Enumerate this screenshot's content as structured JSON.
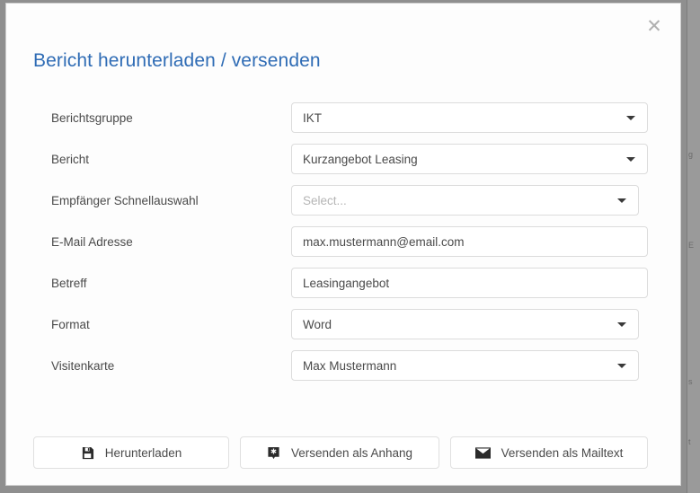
{
  "backdrop": {
    "ghost_text_bottom": "··················",
    "gutter_fragments": [
      "g",
      "E",
      "s",
      "t"
    ]
  },
  "dialog": {
    "title": "Bericht herunterladen / versenden",
    "title_color": "#2f6cb5",
    "close_icon": "close-icon",
    "close_glyph": "✕"
  },
  "form": {
    "fields": [
      {
        "label": "Berichtsgruppe",
        "name": "berichtsgruppe",
        "type": "select",
        "value": "IKT",
        "placeholder": "",
        "is_placeholder": false,
        "width": "wide"
      },
      {
        "label": "Bericht",
        "name": "bericht",
        "type": "select",
        "value": "Kurzangebot Leasing",
        "placeholder": "",
        "is_placeholder": false,
        "width": "wide"
      },
      {
        "label": "Empfänger Schnellauswahl",
        "name": "empfaenger-schnellauswahl",
        "type": "select",
        "value": "Select...",
        "placeholder": "Select...",
        "is_placeholder": true,
        "width": "narrow"
      },
      {
        "label": "E-Mail Adresse",
        "name": "email-adresse",
        "type": "text",
        "value": "max.mustermann@email.com",
        "placeholder": "",
        "is_placeholder": false,
        "width": "wide"
      },
      {
        "label": "Betreff",
        "name": "betreff",
        "type": "text",
        "value": "Leasingangebot",
        "placeholder": "",
        "is_placeholder": false,
        "width": "wide"
      },
      {
        "label": "Format",
        "name": "format",
        "type": "select",
        "value": "Word",
        "placeholder": "",
        "is_placeholder": false,
        "width": "narrow"
      },
      {
        "label": "Visitenkarte",
        "name": "visitenkarte",
        "type": "select",
        "value": "Max Mustermann",
        "placeholder": "",
        "is_placeholder": false,
        "width": "narrow"
      }
    ]
  },
  "footer": {
    "buttons": [
      {
        "name": "herunterladen",
        "label": "Herunterladen",
        "icon": "floppy-disk-icon"
      },
      {
        "name": "versenden-als-anhang",
        "label": "Versenden als Anhang",
        "icon": "paperclip-badge-icon"
      },
      {
        "name": "versenden-als-mailtext",
        "label": "Versenden als Mailtext",
        "icon": "envelope-icon"
      }
    ]
  }
}
